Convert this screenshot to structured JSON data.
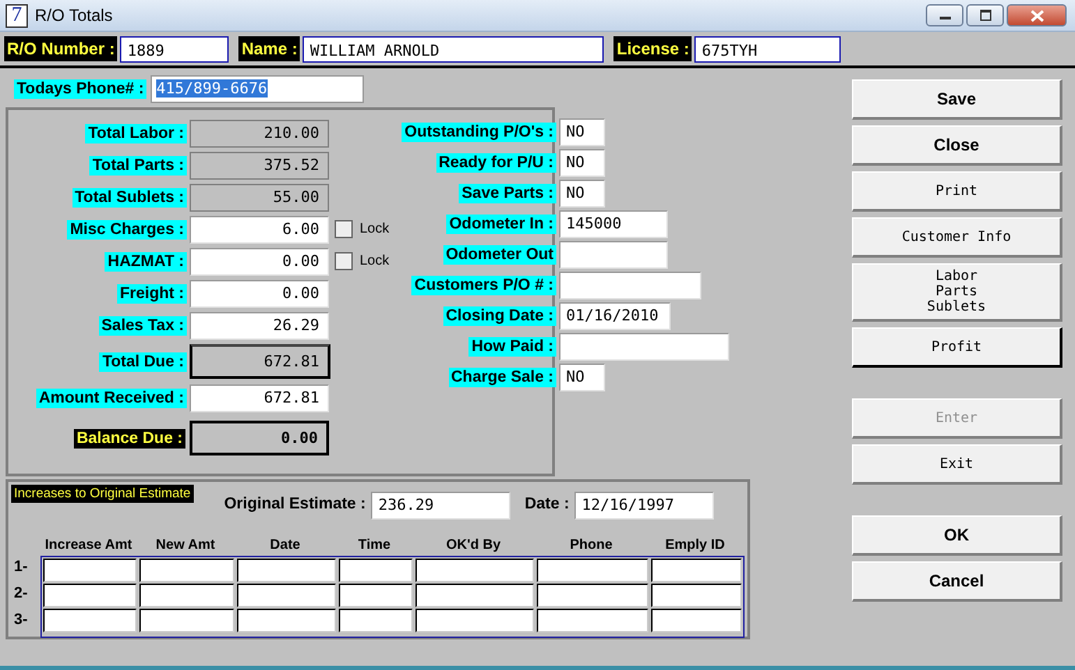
{
  "window": {
    "title": "R/O Totals",
    "icon": "7"
  },
  "header": [
    {
      "label": "R/O Number :",
      "value": "1889"
    },
    {
      "label": "Name :",
      "value": "WILLIAM ARNOLD"
    },
    {
      "label": "License :",
      "value": "675TYH"
    }
  ],
  "phone": {
    "label": "Todays Phone# :",
    "value": "415/899-6676",
    "highlighted": true
  },
  "totals": [
    {
      "label": "Total Labor :",
      "value": "210.00",
      "kind": "readonly"
    },
    {
      "label": "Total Parts :",
      "value": "375.52",
      "kind": "readonly"
    },
    {
      "label": "Total Sublets :",
      "value": "55.00",
      "kind": "readonly"
    },
    {
      "label": "Misc Charges :",
      "value": "6.00",
      "kind": "input",
      "lock": {
        "label": "Lock",
        "checked": false
      }
    },
    {
      "label": "HAZMAT :",
      "value": "0.00",
      "kind": "input",
      "lock": {
        "label": "Lock",
        "checked": false
      }
    },
    {
      "label": "Freight :",
      "value": "0.00",
      "kind": "input"
    },
    {
      "label": "Sales Tax :",
      "value": "26.29",
      "kind": "input"
    },
    {
      "label": "Total Due :",
      "value": "672.81",
      "kind": "total"
    },
    {
      "label": "Amount Received :",
      "value": "672.81",
      "kind": "input"
    },
    {
      "label": "Balance Due :",
      "value": "0.00",
      "kind": "balance"
    }
  ],
  "status": [
    {
      "label": "Outstanding P/O's :",
      "value": "NO"
    },
    {
      "label": "Ready for P/U :",
      "value": "NO"
    },
    {
      "label": "Save Parts :",
      "value": "NO"
    },
    {
      "label": "Odometer In :",
      "value": "145000"
    },
    {
      "label": "Odometer Out"
    },
    {
      "label": "Customers P/O # :"
    },
    {
      "label": "Closing Date :",
      "value": "01/16/2010"
    },
    {
      "label": "How Paid :"
    },
    {
      "label": "Charge Sale :",
      "value": "NO"
    }
  ],
  "increases": {
    "title": "Increases to Original Estimate",
    "original_estimate": {
      "label": "Original Estimate :",
      "value": "236.29"
    },
    "date": {
      "label": "Date :",
      "value": "12/16/1997"
    },
    "columns": [
      "Increase Amt",
      "New Amt",
      "Date",
      "Time",
      "OK'd By",
      "Phone",
      "Emply ID"
    ],
    "rows": [
      "1-",
      "2-",
      "3-"
    ]
  },
  "button_groups": [
    [
      {
        "label": "Save",
        "bold": true,
        "disabled": false,
        "focused": false
      },
      {
        "label": "Close",
        "bold": true,
        "disabled": false,
        "focused": false
      },
      {
        "label": "Print",
        "bold": false,
        "disabled": false,
        "focused": false
      },
      {
        "label": "Customer Info",
        "bold": false,
        "disabled": false,
        "focused": false
      },
      {
        "label": "Labor\nParts\nSublets",
        "bold": false,
        "disabled": false,
        "focused": false
      },
      {
        "label": "Profit",
        "bold": false,
        "disabled": false,
        "focused": true
      }
    ],
    [
      {
        "label": "Enter",
        "bold": false,
        "disabled": true,
        "focused": false
      },
      {
        "label": "Exit",
        "bold": false,
        "disabled": false,
        "focused": false
      }
    ],
    [
      {
        "label": "OK",
        "bold": true,
        "disabled": false,
        "focused": false
      },
      {
        "label": "Cancel",
        "bold": true,
        "disabled": false,
        "focused": false
      }
    ]
  ]
}
